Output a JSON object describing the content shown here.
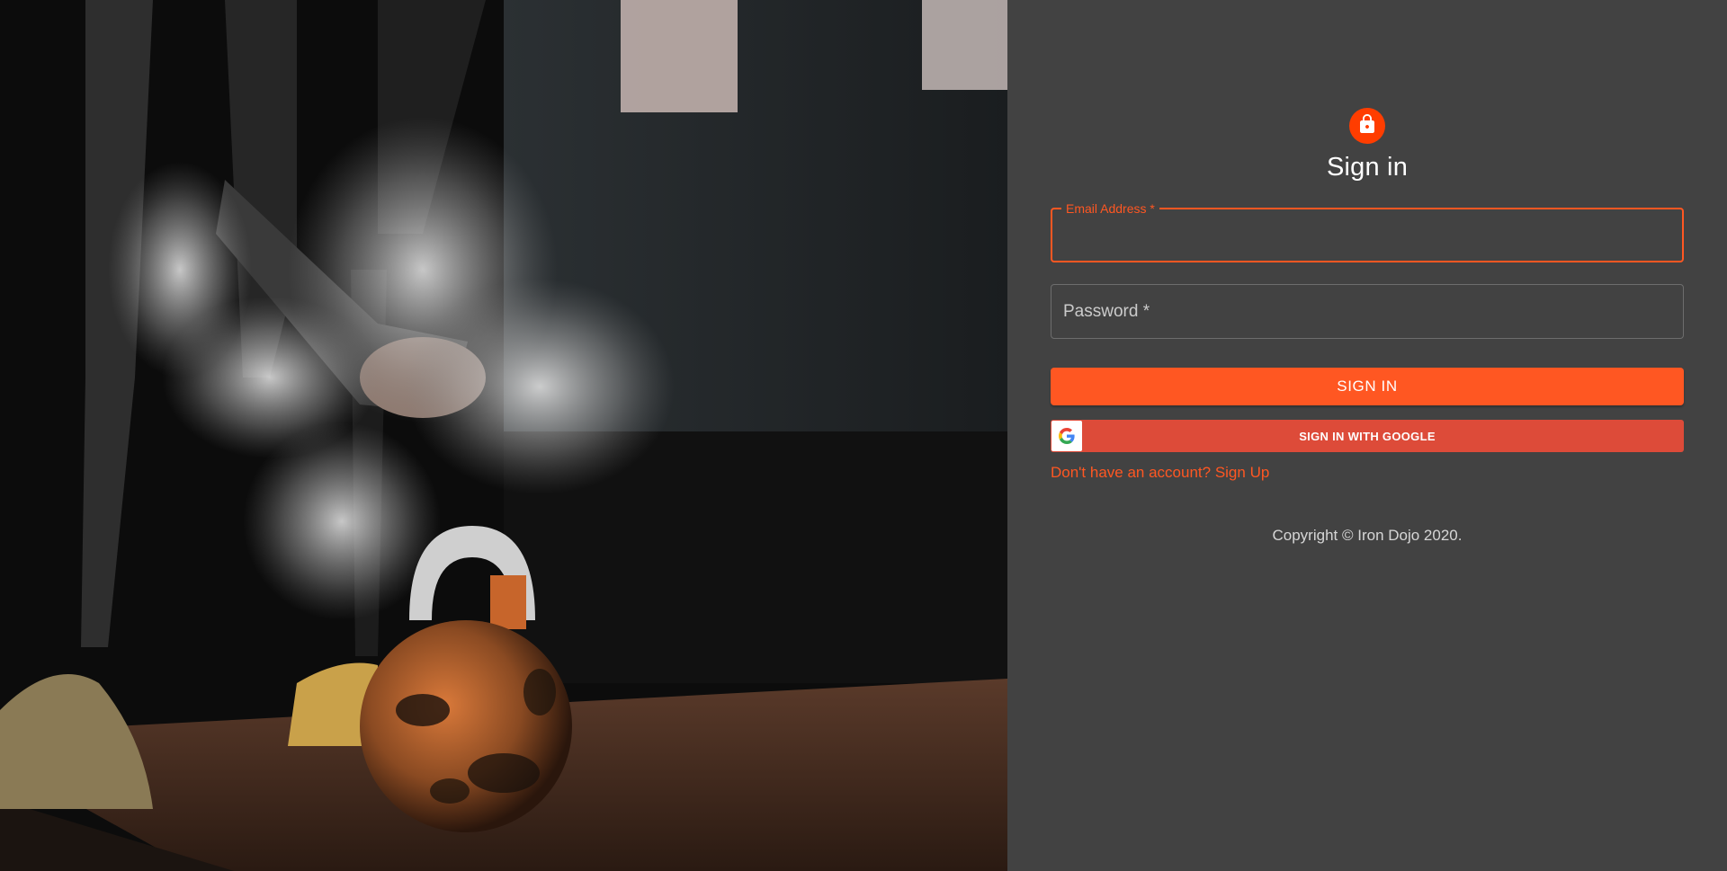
{
  "hero": {
    "image": "gym-kettlebell-chalk-photo"
  },
  "auth": {
    "icon": "lock-icon",
    "title": "Sign in",
    "email": {
      "label": "Email Address *",
      "value": ""
    },
    "password": {
      "label": "Password *",
      "value": ""
    },
    "signin_button": "SIGN IN",
    "google_button": "SIGN IN WITH GOOGLE",
    "google_icon": "google-g-icon",
    "signup_link": "Don't have an account? Sign Up",
    "copyright": "Copyright © Iron Dojo 2020."
  },
  "colors": {
    "panel_bg": "#424242",
    "accent": "#ff5722",
    "avatar": "#ff3d00",
    "google": "#dd4b39"
  }
}
